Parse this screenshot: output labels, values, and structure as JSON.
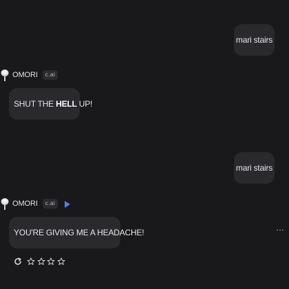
{
  "messages": [
    {
      "role": "user",
      "text": "mari stairs"
    },
    {
      "role": "character",
      "name": "OMORI",
      "badge": "c.ai",
      "text_before": "SHUT THE ",
      "text_bold": "HELL",
      "text_after": " UP!"
    },
    {
      "role": "user",
      "text": "mari stairs"
    },
    {
      "role": "character",
      "name": "OMORI",
      "badge": "c.ai",
      "text": "YOU'RE GIVING ME A HEADACHE!"
    }
  ],
  "icons": {
    "avatar": "avatar-icon",
    "play": "play-icon",
    "more": "more-icon",
    "regenerate": "regenerate-icon",
    "star": "star-icon"
  },
  "more_glyph": "…",
  "rating": {
    "stars_total": 4,
    "stars_filled": 0
  },
  "colors": {
    "background": "#19191b",
    "bubble": "#2a2a2e",
    "accent": "#5b7cf0"
  }
}
